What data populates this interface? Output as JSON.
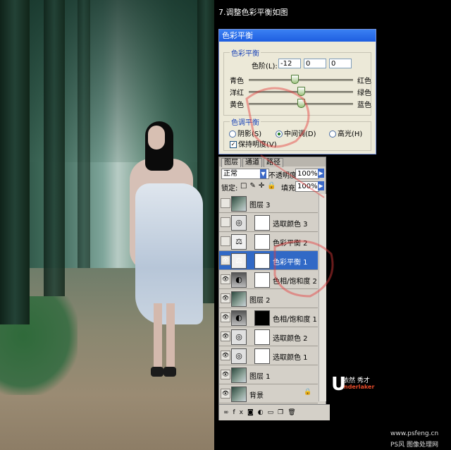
{
  "caption": "7.调整色彩平衡如图",
  "dialog": {
    "title": "色彩平衡",
    "balance_group": "色彩平衡",
    "levels_label": "色阶(L):",
    "levels": [
      "-12",
      "0",
      "0"
    ],
    "sliders": [
      {
        "left": "青色",
        "right": "红色",
        "value": -12
      },
      {
        "left": "洋红",
        "right": "绿色",
        "value": 0
      },
      {
        "left": "黄色",
        "right": "蓝色",
        "value": 0
      }
    ],
    "tone_group": "色调平衡",
    "tones": [
      "阴影(S)",
      "中间调(D)",
      "高光(H)"
    ],
    "selected_tone": "中间调(D)",
    "preserve": "保持明度(V)",
    "preserve_checked": true
  },
  "layers_panel": {
    "tabs": [
      "图层",
      "通道",
      "路径"
    ],
    "active_tab": "图层",
    "blend_mode": "正常",
    "opacity_label": "不透明度:",
    "opacity": "100%",
    "lock_label": "锁定:",
    "fill_label": "填充:",
    "fill": "100%",
    "layers": [
      {
        "name": "图层 3",
        "type": "photo",
        "visible": false,
        "mask": false
      },
      {
        "name": "选取颜色 3",
        "type": "adjust",
        "visible": false,
        "mask": true
      },
      {
        "name": "色彩平衡 2",
        "type": "balance",
        "visible": false,
        "mask": true
      },
      {
        "name": "色彩平衡 1",
        "type": "balance",
        "visible": true,
        "mask": true,
        "selected": true
      },
      {
        "name": "色相/饱和度 2",
        "type": "hue",
        "visible": true,
        "mask": true
      },
      {
        "name": "图层 2",
        "type": "photo",
        "visible": true,
        "mask": false
      },
      {
        "name": "色相/饱和度 1",
        "type": "hue",
        "visible": true,
        "mask": true
      },
      {
        "name": "选取颜色 2",
        "type": "adjust",
        "visible": true,
        "mask": true
      },
      {
        "name": "选取颜色 1",
        "type": "adjust",
        "visible": true,
        "mask": true
      },
      {
        "name": "图层 1",
        "type": "photo",
        "visible": true,
        "mask": false
      },
      {
        "name": "背景",
        "type": "photo",
        "visible": true,
        "mask": false,
        "locked": true
      }
    ]
  },
  "brand": {
    "letter": "U",
    "name": "依然 秀才",
    "english": "nderlaker"
  },
  "footer": {
    "url": "www.psfeng.cn",
    "site": "PS风 图像处理网"
  },
  "colors": {
    "selection": "#3169c6",
    "titlebar": "#1f5ee0",
    "brand_red": "#e54b2a"
  }
}
